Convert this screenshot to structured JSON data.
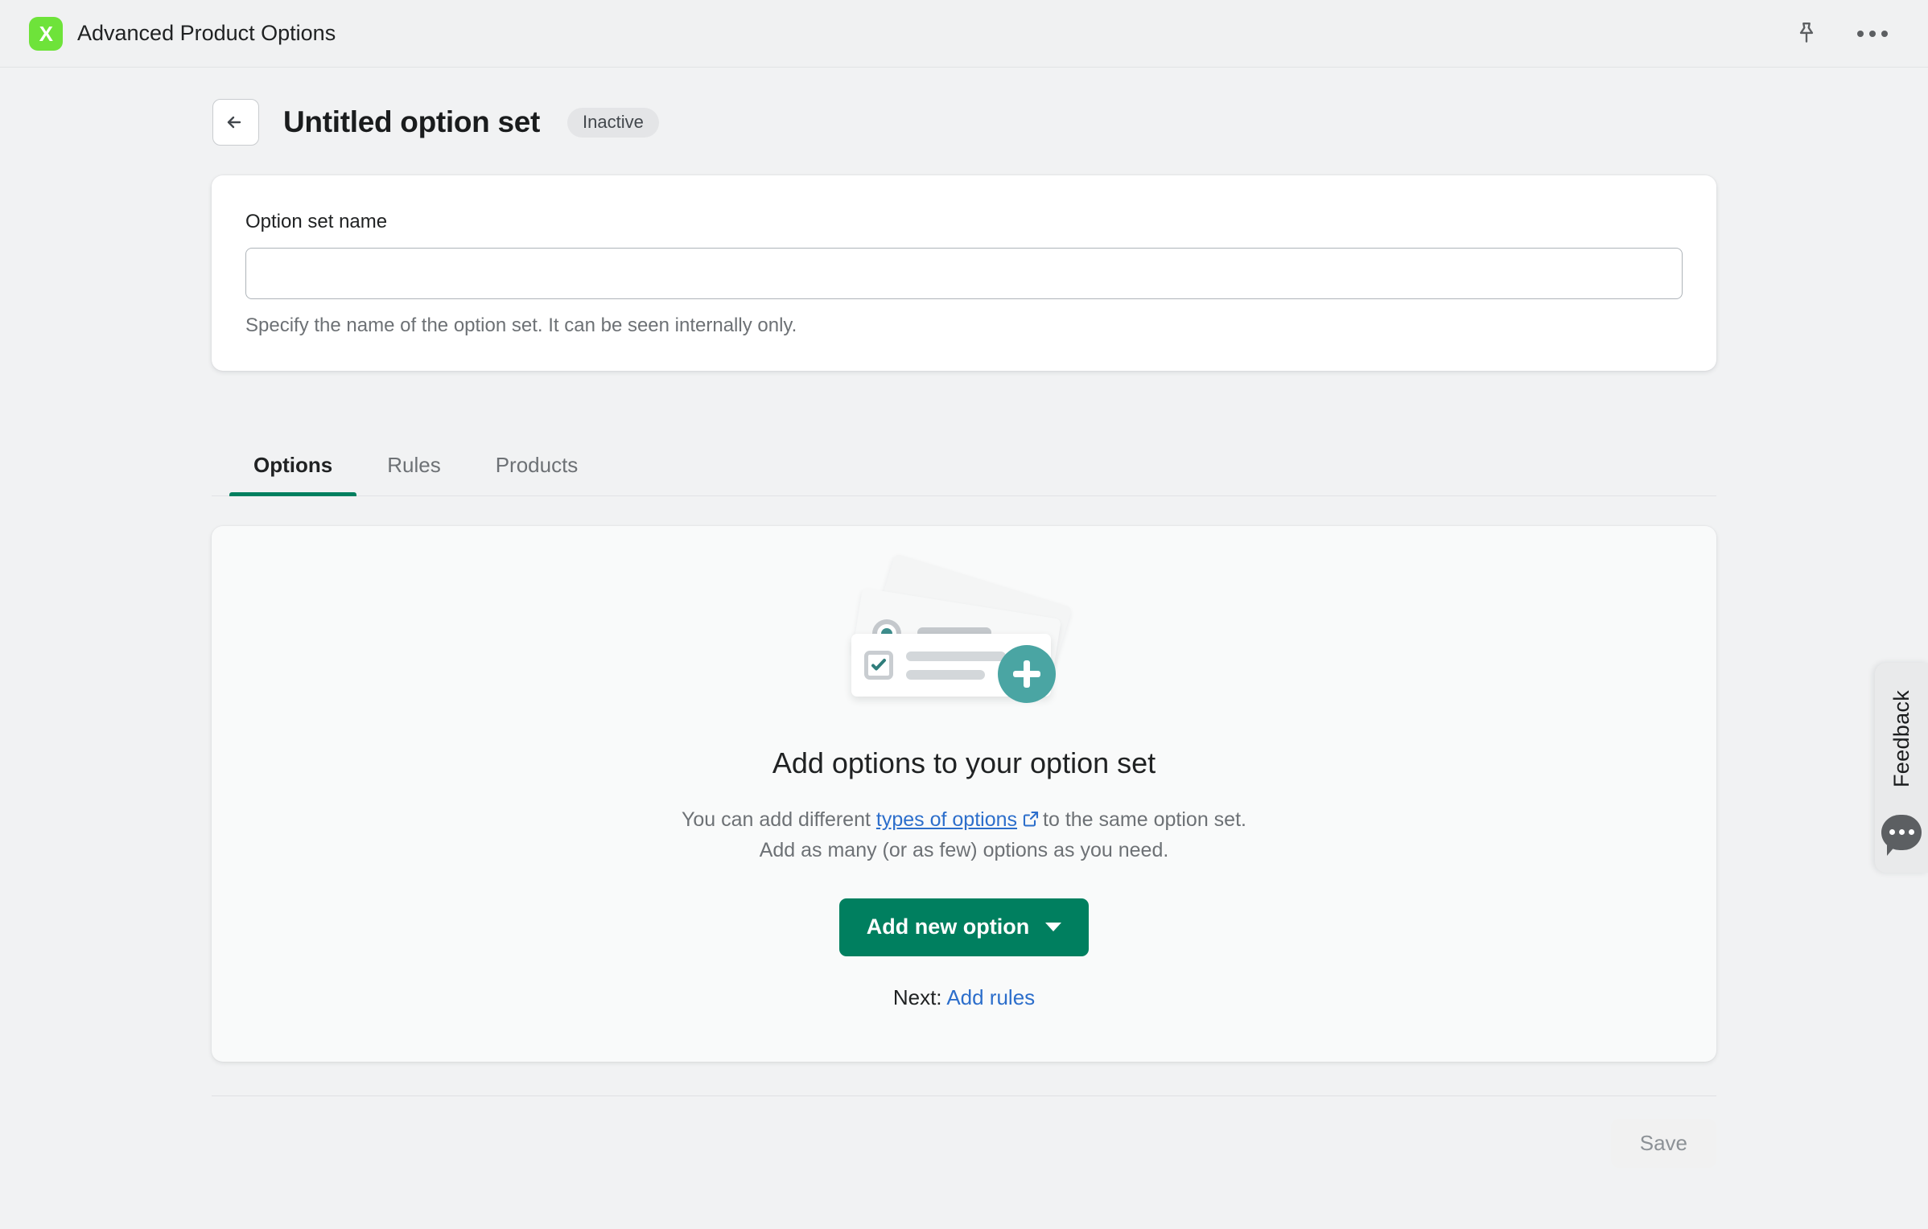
{
  "appbar": {
    "logo_letter": "X",
    "title": "Advanced Product Options",
    "pin_icon": "pin-icon",
    "more_icon": "more-horizontal-icon"
  },
  "header": {
    "back_icon": "arrow-left-icon",
    "title": "Untitled option set",
    "status_badge": "Inactive"
  },
  "name_card": {
    "label": "Option set name",
    "value": "",
    "placeholder": "",
    "helper": "Specify the name of the option set. It can be seen internally only."
  },
  "tabs": [
    {
      "label": "Options",
      "active": true
    },
    {
      "label": "Rules",
      "active": false
    },
    {
      "label": "Products",
      "active": false
    }
  ],
  "empty_state": {
    "illustration": "stacked-option-cards-with-plus-illustration",
    "title": "Add options to your option set",
    "body_prefix": "You can add different",
    "body_link": "types of options",
    "external_icon": "external-link-icon",
    "body_suffix": "to the same option set.",
    "body_line2": "Add as many (or as few) options as you need.",
    "add_button": "Add new option",
    "add_button_caret": "chevron-down-icon",
    "next_prefix": "Next:",
    "next_link": "Add rules"
  },
  "footer": {
    "save_label": "Save"
  },
  "feedback": {
    "label": "Feedback",
    "icon": "chat-bubble-icon"
  },
  "colors": {
    "accent_green": "#007F5F",
    "logo_green": "#6EE33A",
    "link_blue": "#2C6ECB",
    "teal": "#4AA5A3",
    "page_bg": "#F1F2F3"
  }
}
